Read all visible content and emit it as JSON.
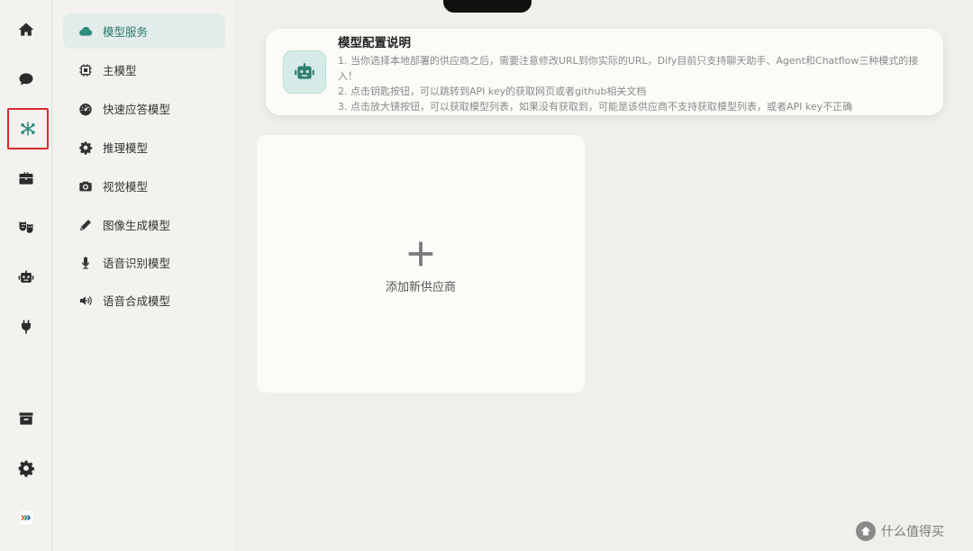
{
  "rail": {
    "items": [
      {
        "icon": "home-icon"
      },
      {
        "icon": "chat-bubble-icon"
      },
      {
        "icon": "model-network-icon",
        "selected": true
      },
      {
        "icon": "toolbox-icon"
      },
      {
        "icon": "theater-masks-icon"
      },
      {
        "icon": "robot-icon"
      },
      {
        "icon": "plug-icon"
      },
      {
        "icon": "archive-box-icon"
      },
      {
        "icon": "gear-icon"
      },
      {
        "icon": "app-logo-icon"
      }
    ],
    "selected_color": "#d9282f"
  },
  "menu": {
    "items": [
      {
        "label": "模型服务",
        "icon": "cloud-icon",
        "active": true
      },
      {
        "label": "主模型",
        "icon": "chip-icon"
      },
      {
        "label": "快速应答模型",
        "icon": "speedometer-icon"
      },
      {
        "label": "推理模型",
        "icon": "gear-icon"
      },
      {
        "label": "视觉模型",
        "icon": "camera-icon"
      },
      {
        "label": "图像生成模型",
        "icon": "pencil-icon"
      },
      {
        "label": "语音识别模型",
        "icon": "microphone-icon"
      },
      {
        "label": "语音合成模型",
        "icon": "speaker-icon"
      }
    ],
    "accent": "#2b7a6f"
  },
  "info": {
    "title": "模型配置说明",
    "lines": [
      "1. 当你选择本地部署的供应商之后，需要注意修改URL到你实际的URL，Dify目前只支持聊天助手、Agent和Chatflow三种模式的接入！",
      "2. 点击钥匙按钮，可以跳转到API key的获取网页或者github相关文档",
      "3. 点击放大镜按钮，可以获取模型列表，如果没有获取到，可能是该供应商不支持获取模型列表，或者API key不正确"
    ]
  },
  "add_provider": {
    "label": "添加新供应商"
  },
  "watermark": {
    "text": "什么值得买"
  }
}
